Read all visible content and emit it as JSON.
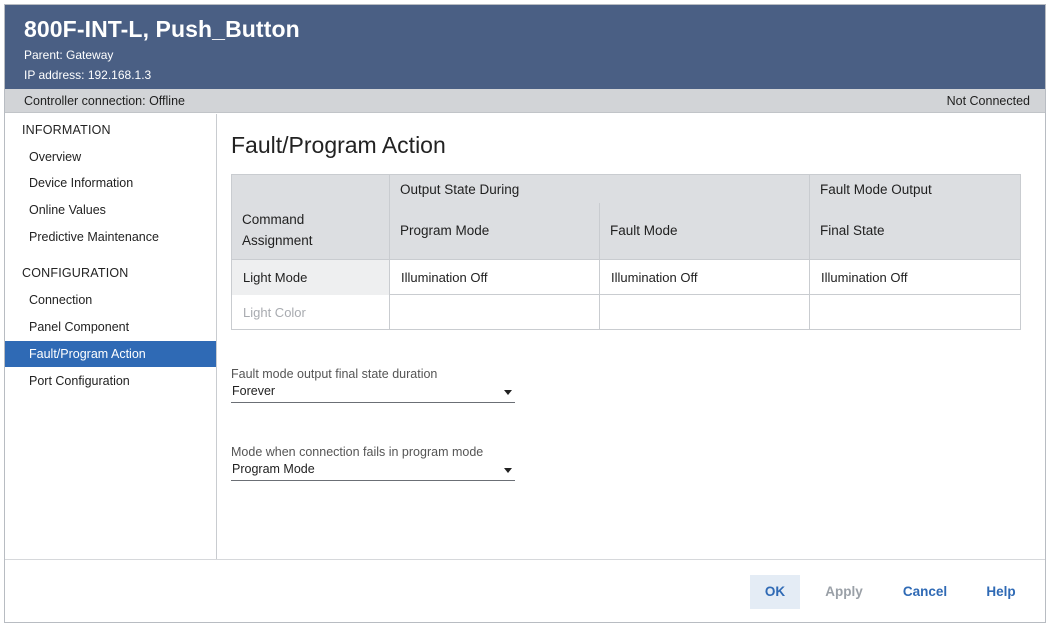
{
  "header": {
    "title": "800F-INT-L, Push_Button",
    "parent": "Parent:  Gateway",
    "ip": "IP address:  192.168.1.3"
  },
  "status": {
    "left": "Controller connection: Offline",
    "right": "Not Connected"
  },
  "sidebar": {
    "info_heading": "INFORMATION",
    "info_items": [
      "Overview",
      "Device Information",
      "Online Values",
      "Predictive Maintenance"
    ],
    "config_heading": "CONFIGURATION",
    "config_items": [
      "Connection",
      "Panel Component",
      "Fault/Program Action",
      "Port Configuration"
    ],
    "active": "Fault/Program Action"
  },
  "main": {
    "title": "Fault/Program Action",
    "table": {
      "group_output": "Output State During",
      "group_fault": "Fault Mode Output",
      "col_command_line1": "Command",
      "col_command_line2": "Assignment",
      "col_program": "Program Mode",
      "col_fault": "Fault Mode",
      "col_final": "Final State",
      "rows": [
        {
          "label": "Light Mode",
          "program": "Illumination Off",
          "fault": "Illumination Off",
          "final": "Illumination Off"
        },
        {
          "label": "Light Color",
          "program": "",
          "fault": "",
          "final": ""
        }
      ]
    },
    "duration": {
      "label": "Fault mode output final state duration",
      "value": "Forever"
    },
    "mode": {
      "label": "Mode when connection fails in program mode",
      "value": "Program Mode"
    }
  },
  "footer": {
    "ok": "OK",
    "apply": "Apply",
    "cancel": "Cancel",
    "help": "Help"
  },
  "colors": {
    "header_bg": "#4a5f84",
    "accent": "#2f6ab5",
    "status_bg": "#d2d4d7"
  }
}
